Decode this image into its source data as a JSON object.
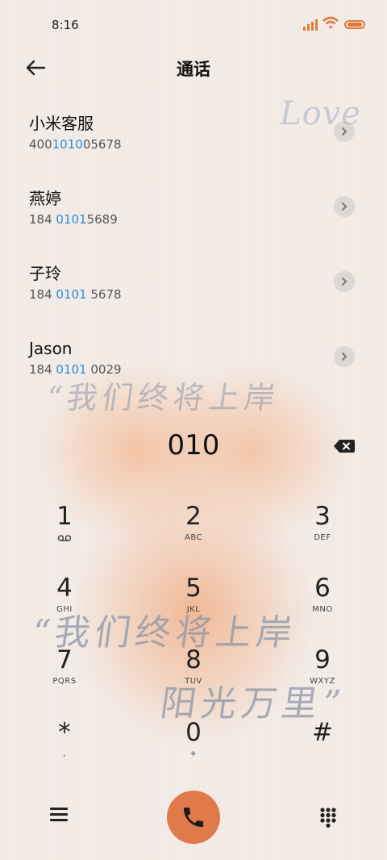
{
  "status": {
    "time": "8:16"
  },
  "header": {
    "title": "通话"
  },
  "decor": {
    "love": "Love",
    "line1": "“我们终将上岸",
    "line2": "“我们终将上岸",
    "line3": "阳光万里”"
  },
  "contacts": [
    {
      "name": "小米客服",
      "num_pre": "400",
      "num_hl": "1010",
      "num_post": "05678"
    },
    {
      "name": "燕婷",
      "num_pre": "184 ",
      "num_hl": "0101",
      "num_post": "5689"
    },
    {
      "name": "子玲",
      "num_pre": "184 ",
      "num_hl": "0101",
      "num_post": " 5678"
    },
    {
      "name": "Jason",
      "num_pre": "184 ",
      "num_hl": "0101",
      "num_post": " 0029"
    }
  ],
  "dialer": {
    "number": "010"
  },
  "keys": [
    {
      "digit": "1",
      "letters": ""
    },
    {
      "digit": "2",
      "letters": "ABC"
    },
    {
      "digit": "3",
      "letters": "DEF"
    },
    {
      "digit": "4",
      "letters": "GHI"
    },
    {
      "digit": "5",
      "letters": "JKL"
    },
    {
      "digit": "6",
      "letters": "MNO"
    },
    {
      "digit": "7",
      "letters": "PQRS"
    },
    {
      "digit": "8",
      "letters": "TUV"
    },
    {
      "digit": "9",
      "letters": "WXYZ"
    },
    {
      "digit": "*",
      "letters": ","
    },
    {
      "digit": "0",
      "letters": "+"
    },
    {
      "digit": "#",
      "letters": ""
    }
  ],
  "colors": {
    "accent": "#e07a4a",
    "highlight": "#2a8de0"
  },
  "icons": {
    "back": "arrow-left-icon",
    "chevron": "chevron-right-icon",
    "backspace": "backspace-icon",
    "voicemail": "voicemail-icon",
    "menu": "menu-icon",
    "call": "phone-icon",
    "keypad": "dialpad-icon"
  }
}
